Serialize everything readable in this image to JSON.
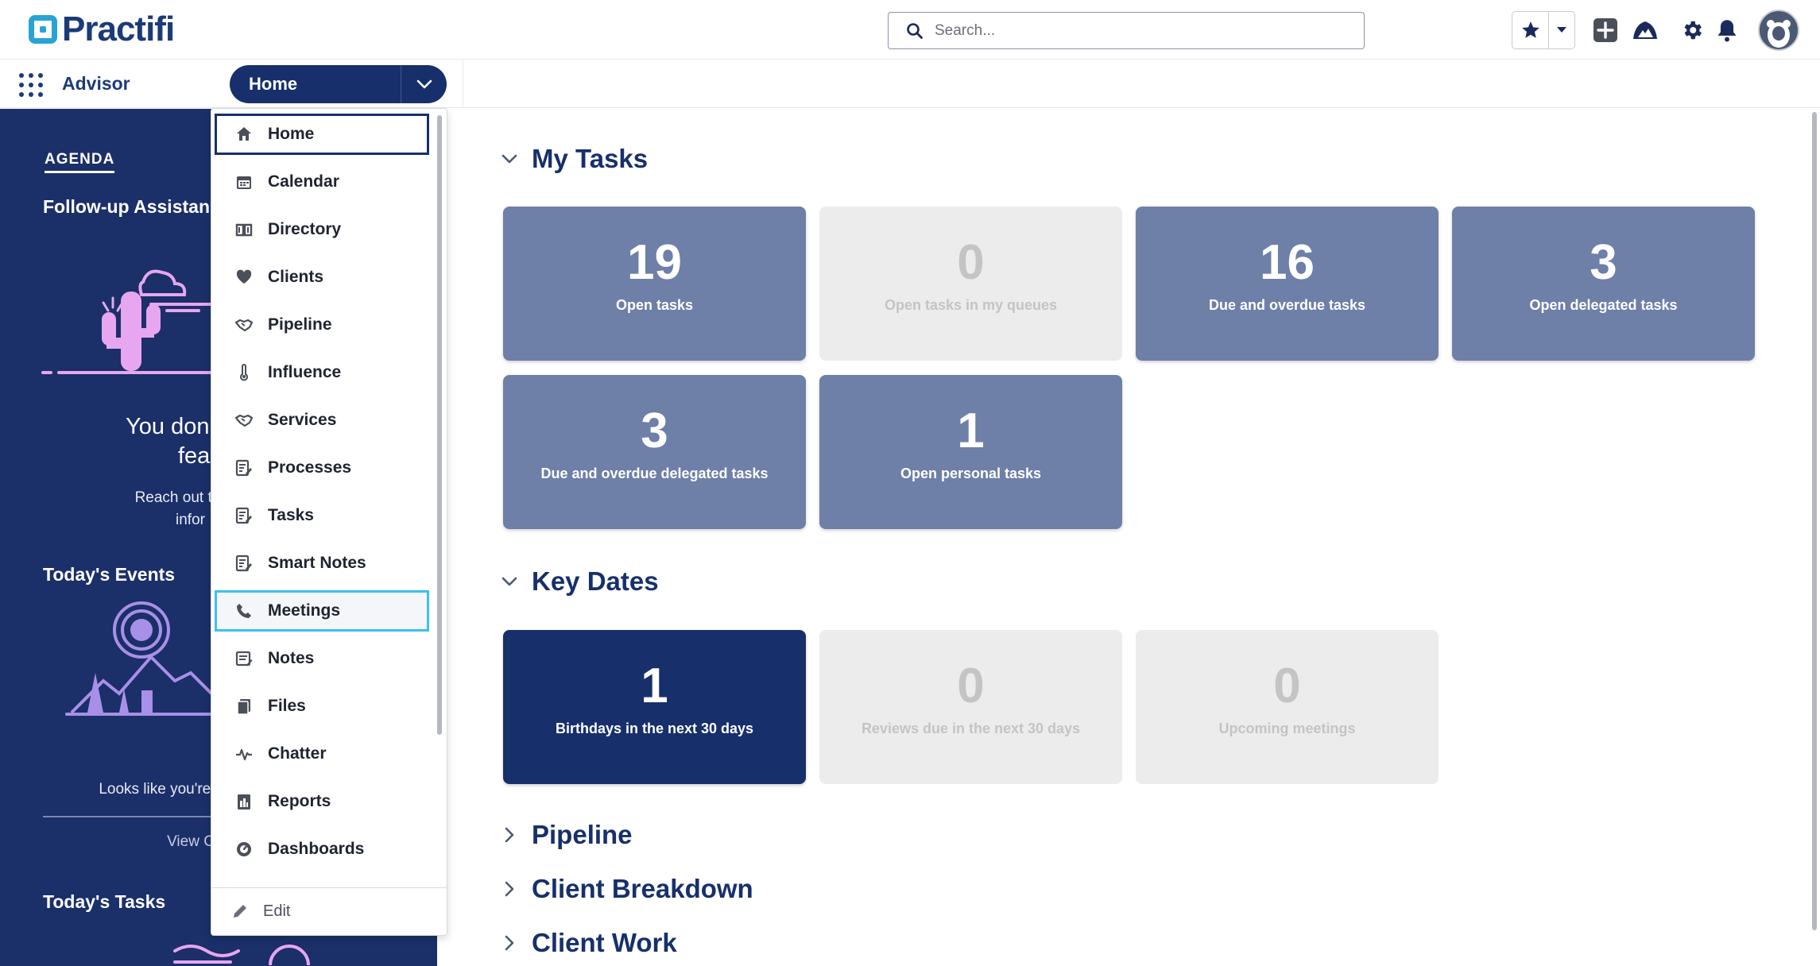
{
  "header": {
    "logo_text": "Practifi",
    "search_placeholder": "Search..."
  },
  "nav": {
    "app_name": "Advisor",
    "current_item": "Home"
  },
  "agenda": {
    "tab": "AGENDA",
    "followup_title": "Follow-up Assistan",
    "no_feature_line1": "You don't hav",
    "no_feature_line2": "fea",
    "reach_out_line1": "Reach out to your a",
    "reach_out_line2": "infor",
    "events_title": "Today's Events",
    "free_text": "Looks like you're free an",
    "view_link": "View C",
    "tasks_title": "Today's Tasks"
  },
  "menu": {
    "items": [
      {
        "label": "Home",
        "icon": "home-icon"
      },
      {
        "label": "Calendar",
        "icon": "calendar-icon"
      },
      {
        "label": "Directory",
        "icon": "directory-icon"
      },
      {
        "label": "Clients",
        "icon": "heart-icon"
      },
      {
        "label": "Pipeline",
        "icon": "handshake-icon"
      },
      {
        "label": "Influence",
        "icon": "thermometer-icon"
      },
      {
        "label": "Services",
        "icon": "handshake-icon"
      },
      {
        "label": "Processes",
        "icon": "checklist-icon"
      },
      {
        "label": "Tasks",
        "icon": "checklist-icon"
      },
      {
        "label": "Smart Notes",
        "icon": "checklist-icon"
      },
      {
        "label": "Meetings",
        "icon": "phone-icon"
      },
      {
        "label": "Notes",
        "icon": "note-icon"
      },
      {
        "label": "Files",
        "icon": "files-icon"
      },
      {
        "label": "Chatter",
        "icon": "pulse-icon"
      },
      {
        "label": "Reports",
        "icon": "report-icon"
      },
      {
        "label": "Dashboards",
        "icon": "gauge-icon"
      }
    ],
    "active_item": "Home",
    "hovered_item": "Meetings",
    "edit_label": "Edit"
  },
  "main": {
    "my_tasks": {
      "title": "My Tasks",
      "cards": [
        {
          "value": "19",
          "label": "Open tasks"
        },
        {
          "value": "0",
          "label": "Open tasks in my queues"
        },
        {
          "value": "16",
          "label": "Due and overdue tasks"
        },
        {
          "value": "3",
          "label": "Open delegated tasks"
        },
        {
          "value": "3",
          "label": "Due and overdue delegated tasks"
        },
        {
          "value": "1",
          "label": "Open personal tasks"
        }
      ]
    },
    "key_dates": {
      "title": "Key Dates",
      "cards": [
        {
          "value": "1",
          "label": "Birthdays in the next 30 days"
        },
        {
          "value": "0",
          "label": "Reviews due in the next 30 days"
        },
        {
          "value": "0",
          "label": "Upcoming meetings"
        }
      ]
    },
    "collapsed_sections": [
      "Pipeline",
      "Client Breakdown",
      "Client Work"
    ]
  },
  "colors": {
    "brand_navy": "#17306b",
    "card_medium": "#6e7fa8",
    "card_empty": "#ececec",
    "agenda_bg": "#1b2f69",
    "hover_outline": "#3ec0ee",
    "illustration_pink": "#e7a6f0",
    "illustration_purple": "#a88fe8"
  }
}
